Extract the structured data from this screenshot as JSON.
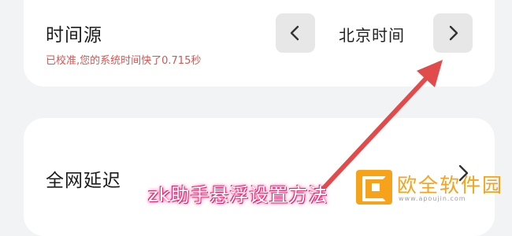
{
  "time_source": {
    "title": "时间源",
    "status": "已校准,您的系统时间快了0.715秒",
    "value": "北京时间",
    "prev_label": "<",
    "next_label": ">"
  },
  "network": {
    "title": "全网延迟"
  },
  "overlay": {
    "caption": "zk助手悬浮设置方法",
    "watermark_name": "欧全软件园",
    "watermark_url": "www.apoujin.com",
    "arrow_color": "#e24b4b"
  }
}
